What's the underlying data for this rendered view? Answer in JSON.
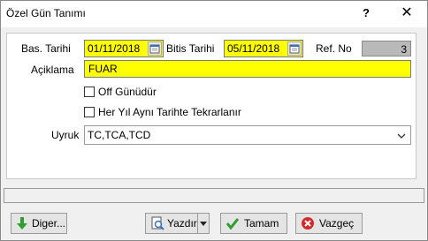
{
  "window": {
    "title": "Özel Gün Tanımı",
    "help_label": "?",
    "close_label": "✕"
  },
  "form": {
    "start_date_label": "Bas. Tarihi",
    "start_date_value": "01/11/2018",
    "end_date_label": "Bitis Tarihi",
    "end_date_value": "05/11/2018",
    "ref_label": "Ref. No",
    "ref_value": "3",
    "description_label": "Açiklama",
    "description_value": "FUAR",
    "off_day_label": "Off Günüdür",
    "off_day_checked": false,
    "repeat_label": "Her Yıl Aynı Tarihte Tekrarlanır",
    "repeat_checked": false,
    "nationality_label": "Uyruk",
    "nationality_value": "TC,TCA,TCD"
  },
  "buttons": {
    "other": "Diger...",
    "print": "Yazdır",
    "ok": "Tamam",
    "cancel": "Vazgeç"
  },
  "colors": {
    "required_field": "#ffff00",
    "readonly_field": "#b9b9b9"
  }
}
